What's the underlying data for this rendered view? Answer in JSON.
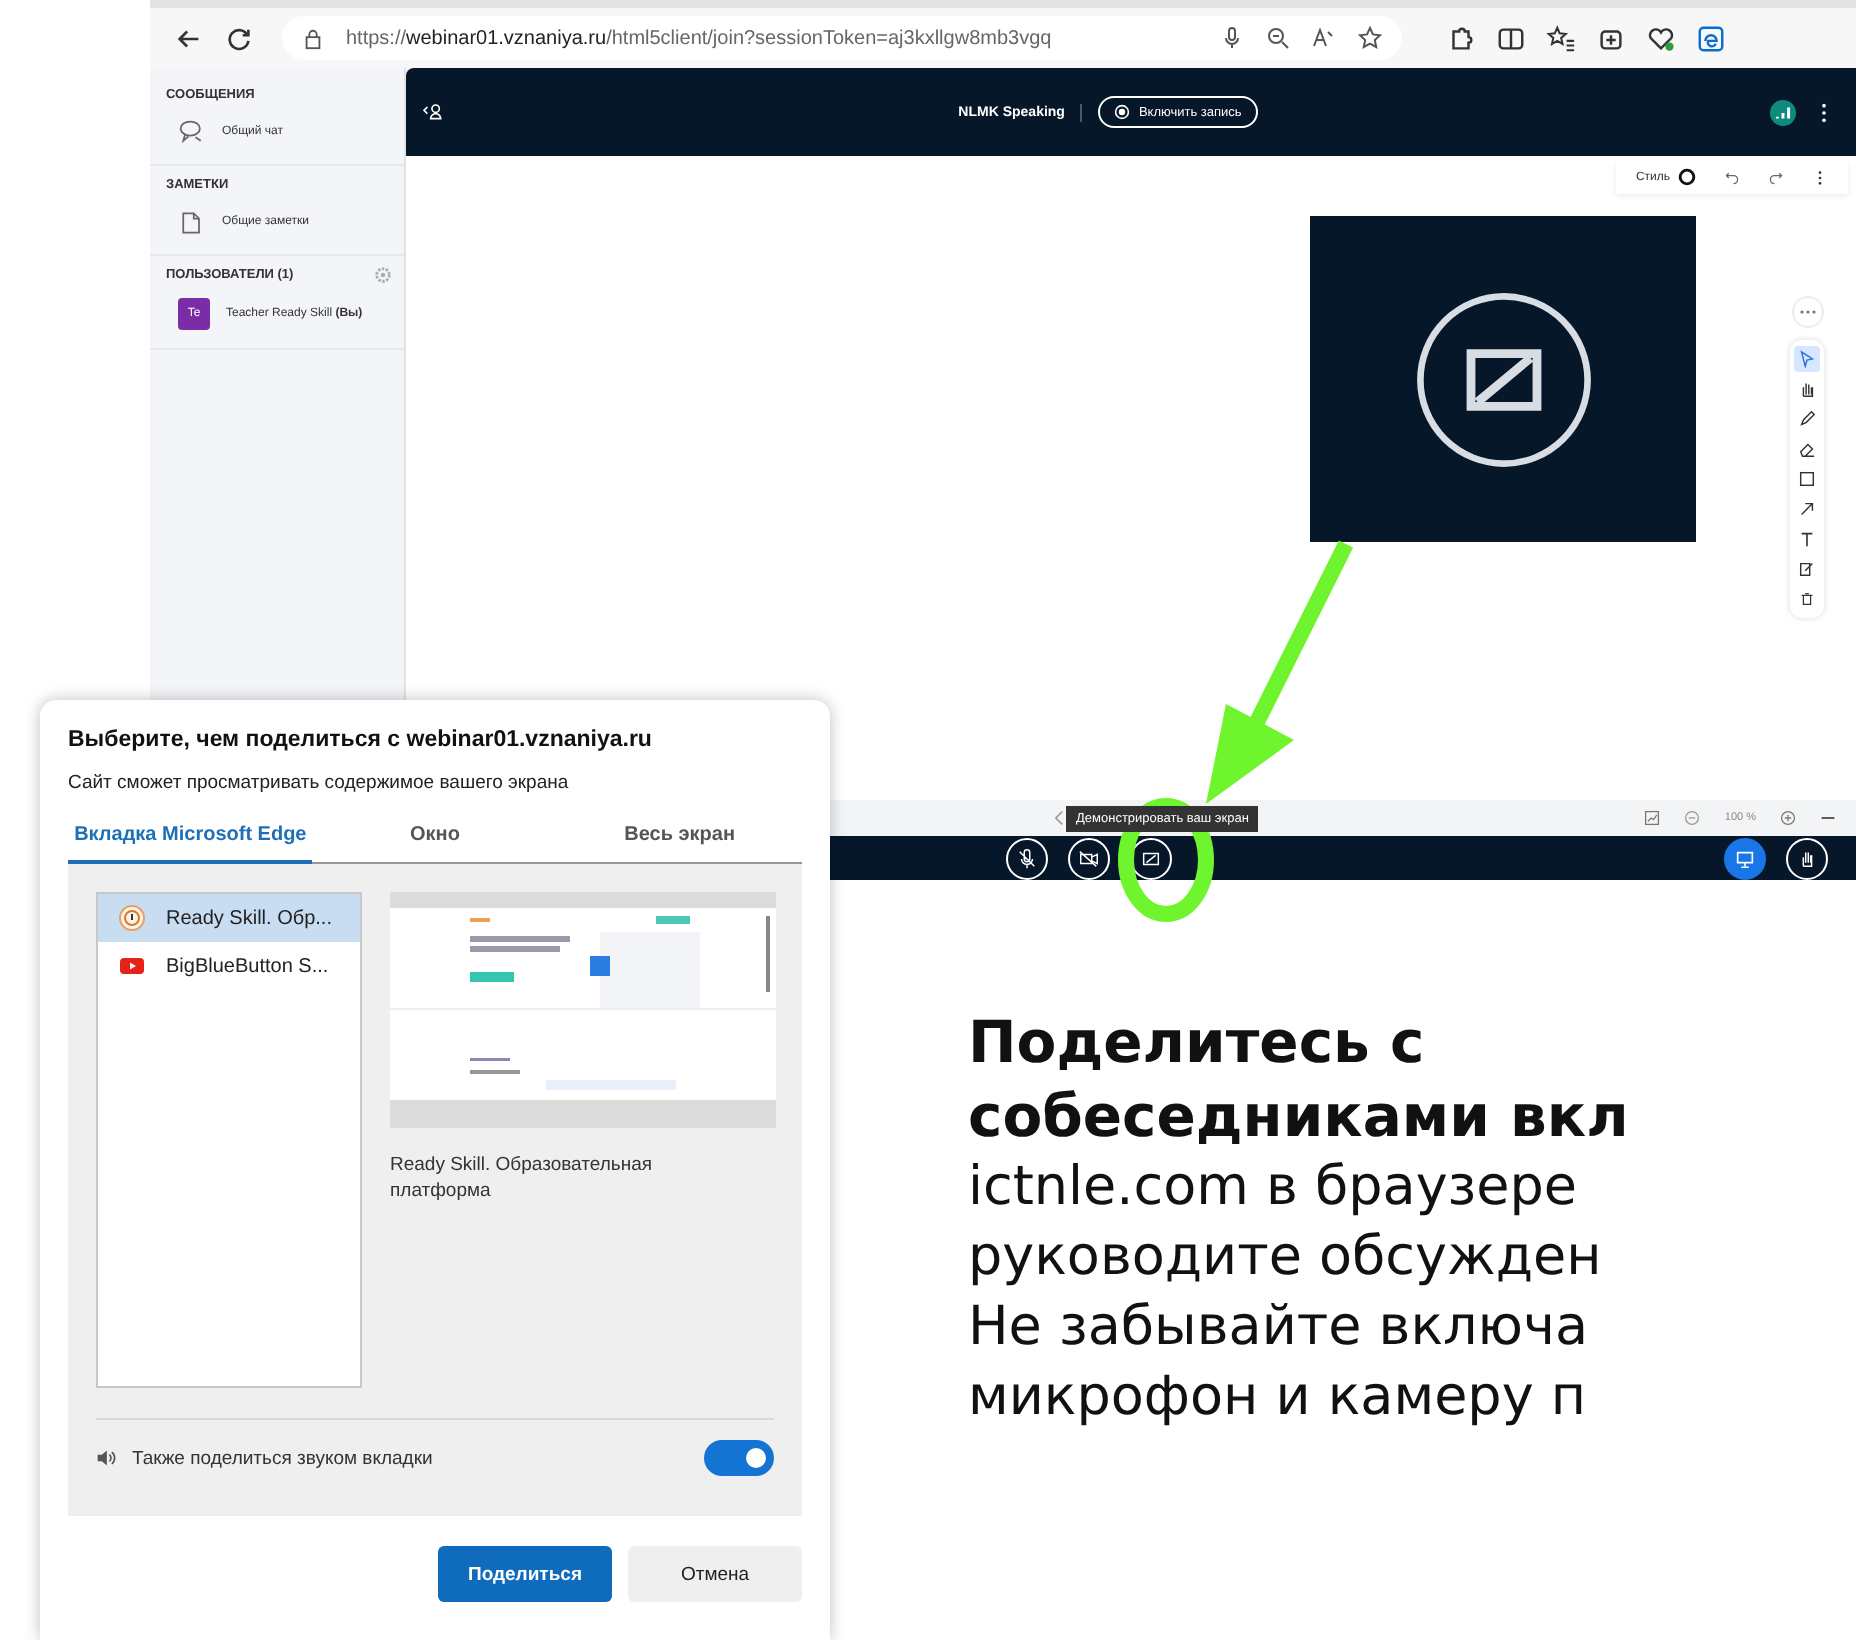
{
  "browser": {
    "url_parts": [
      {
        "kind": "plain",
        "text": "https://"
      },
      {
        "kind": "host",
        "text": "webinar01.vznaniya.ru"
      },
      {
        "kind": "plain",
        "text": "/html5client/join?sessionToken=aj3kxllgw8mb3vgq"
      }
    ]
  },
  "sidebar": {
    "sections": [
      {
        "title": "СООБЩЕНИЯ",
        "settings": false,
        "items": [
          {
            "kind": "chat",
            "label": "Общий чат"
          }
        ]
      },
      {
        "title": "ЗАМЕТКИ",
        "settings": false,
        "items": [
          {
            "kind": "notes",
            "label": "Общие заметки"
          }
        ]
      },
      {
        "title": "ПОЛЬЗОВАТЕЛИ (1)",
        "settings": true,
        "items": [
          {
            "kind": "user",
            "avatar": "Te",
            "label": "Teacher Ready Skill **(Вы)**"
          }
        ]
      }
    ]
  },
  "header": {
    "title": "NLMK Speaking",
    "record_button": "Включить запись"
  },
  "whiteboard": {
    "style_label": "Стиль",
    "tools": [
      {
        "kind": "select",
        "selected": true
      },
      {
        "kind": "hand",
        "selected": false
      },
      {
        "kind": "pencil",
        "selected": false
      },
      {
        "kind": "eraser",
        "selected": false
      },
      {
        "kind": "rectangle",
        "selected": false
      },
      {
        "kind": "arrow",
        "selected": false
      },
      {
        "kind": "text",
        "selected": false
      },
      {
        "kind": "note",
        "selected": false
      },
      {
        "kind": "trash",
        "selected": false
      }
    ]
  },
  "zoom": {
    "level_label": "100 %"
  },
  "tooltip": "Демонстрировать ваш экран",
  "action_bar": [
    {
      "kind": "mic",
      "active": false
    },
    {
      "kind": "camera",
      "active": false
    },
    {
      "kind": "screen",
      "active": false
    },
    {
      "kind": "presentation",
      "active": true
    },
    {
      "kind": "hand",
      "active": false
    }
  ],
  "dialog": {
    "title": "Выберите, чем поделиться с webinar01.vznaniya.ru",
    "subtitle": "Сайт сможет просматривать содержимое вашего экрана",
    "tabs": [
      {
        "label": "Вкладка Microsoft Edge",
        "selected": true
      },
      {
        "label": "Окно",
        "selected": false
      },
      {
        "label": "Весь экран",
        "selected": false
      }
    ],
    "sources": [
      {
        "kind": "site",
        "label": "Ready Skill. Обр...",
        "selected": true
      },
      {
        "kind": "video",
        "label": "BigBlueButton S...",
        "selected": false
      }
    ],
    "preview_caption": "Ready Skill. Образовательная платформа",
    "audio": {
      "label": "Также поделиться звуком вкладки",
      "on": true
    },
    "buttons": [
      {
        "kind": "primary",
        "label": "Поделиться"
      },
      {
        "kind": "secondary",
        "label": "Отмена"
      }
    ]
  },
  "callout": {
    "heading_lines": [
      "Поделитесь с",
      "собеседниками вкл"
    ],
    "body_lines": [
      "ictnle.com в браузере",
      "руководите обсужден",
      "Не забывайте включа",
      "микрофон и камеру п"
    ]
  }
}
